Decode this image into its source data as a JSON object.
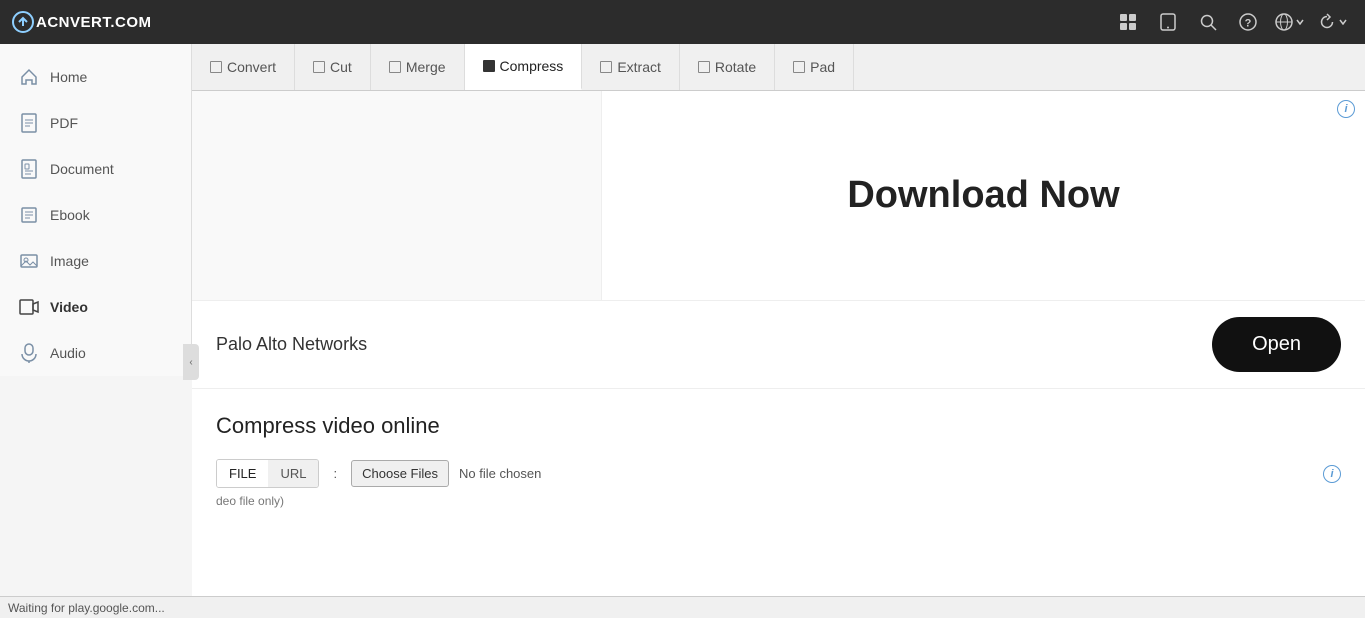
{
  "navbar": {
    "logo_text": "AC",
    "logo_text2": "NVERT.COM",
    "icons": [
      "grid-icon",
      "tablet-icon",
      "search-icon",
      "help-icon",
      "language-icon",
      "refresh-icon"
    ]
  },
  "sidebar": {
    "items": [
      {
        "id": "home",
        "label": "Home",
        "icon": "house"
      },
      {
        "id": "pdf",
        "label": "PDF",
        "icon": "file-pdf"
      },
      {
        "id": "document",
        "label": "Document",
        "icon": "file-doc"
      },
      {
        "id": "ebook",
        "label": "Ebook",
        "icon": "book"
      },
      {
        "id": "image",
        "label": "Image",
        "icon": "image"
      },
      {
        "id": "video",
        "label": "Video",
        "icon": "video"
      },
      {
        "id": "audio",
        "label": "Audio",
        "icon": "audio"
      }
    ]
  },
  "tabs": [
    {
      "id": "convert",
      "label": "Convert",
      "active": false
    },
    {
      "id": "cut",
      "label": "Cut",
      "active": false
    },
    {
      "id": "merge",
      "label": "Merge",
      "active": false
    },
    {
      "id": "compress",
      "label": "Compress",
      "active": true
    },
    {
      "id": "extract",
      "label": "Extract",
      "active": false
    },
    {
      "id": "rotate",
      "label": "Rotate",
      "active": false
    },
    {
      "id": "pad",
      "label": "Pad",
      "active": false
    }
  ],
  "banner": {
    "download_now": "Download Now"
  },
  "sponsor": {
    "name": "Palo Alto Networks",
    "open_label": "Open"
  },
  "compress_section": {
    "title": "Compress video online",
    "file_btn": "FILE",
    "url_btn": "URL",
    "choose_files_label": "Choose Files",
    "no_file_text": "No file chosen",
    "bottom_hint": "deo file only)"
  },
  "statusbar": {
    "text": "Waiting for play.google.com..."
  }
}
